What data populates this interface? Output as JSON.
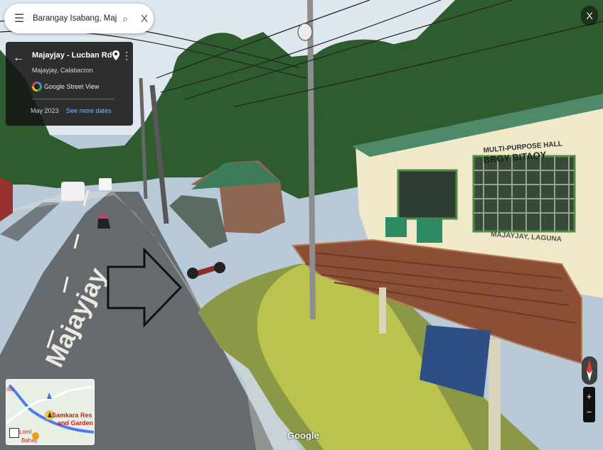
{
  "search": {
    "value": "Barangay Isabang, Majayjay, La"
  },
  "info_card": {
    "road_name": "Majayjay - Lucban Rd",
    "locality": "Majayjay, Calabarzon",
    "provider": "Google Street View",
    "capture_date": "May 2023",
    "see_more_dates": "See more dates"
  },
  "scene": {
    "hall_sign_line1": "MULTI-PURPOSE HALL",
    "hall_sign_line2": "BRGY BITAOY",
    "hall_sign_line3": "MAJAYJAY, LAGUNA",
    "road_marking": "Majayjay"
  },
  "minimap": {
    "place_name_1": "Samkara Res",
    "place_name_2": "and Garden",
    "place_name_3": "Lomi",
    "place_name_4": "Bahay",
    "edge_label": "ms"
  },
  "controls": {
    "close": "X",
    "zoom_in": "+",
    "zoom_out": "−"
  },
  "watermark": "Google",
  "icons": [
    "menu-icon",
    "search-icon",
    "close-icon",
    "back-arrow-icon",
    "location-pin-icon",
    "more-options-icon",
    "google-logo-icon",
    "fullscreen-icon",
    "compass-icon"
  ]
}
